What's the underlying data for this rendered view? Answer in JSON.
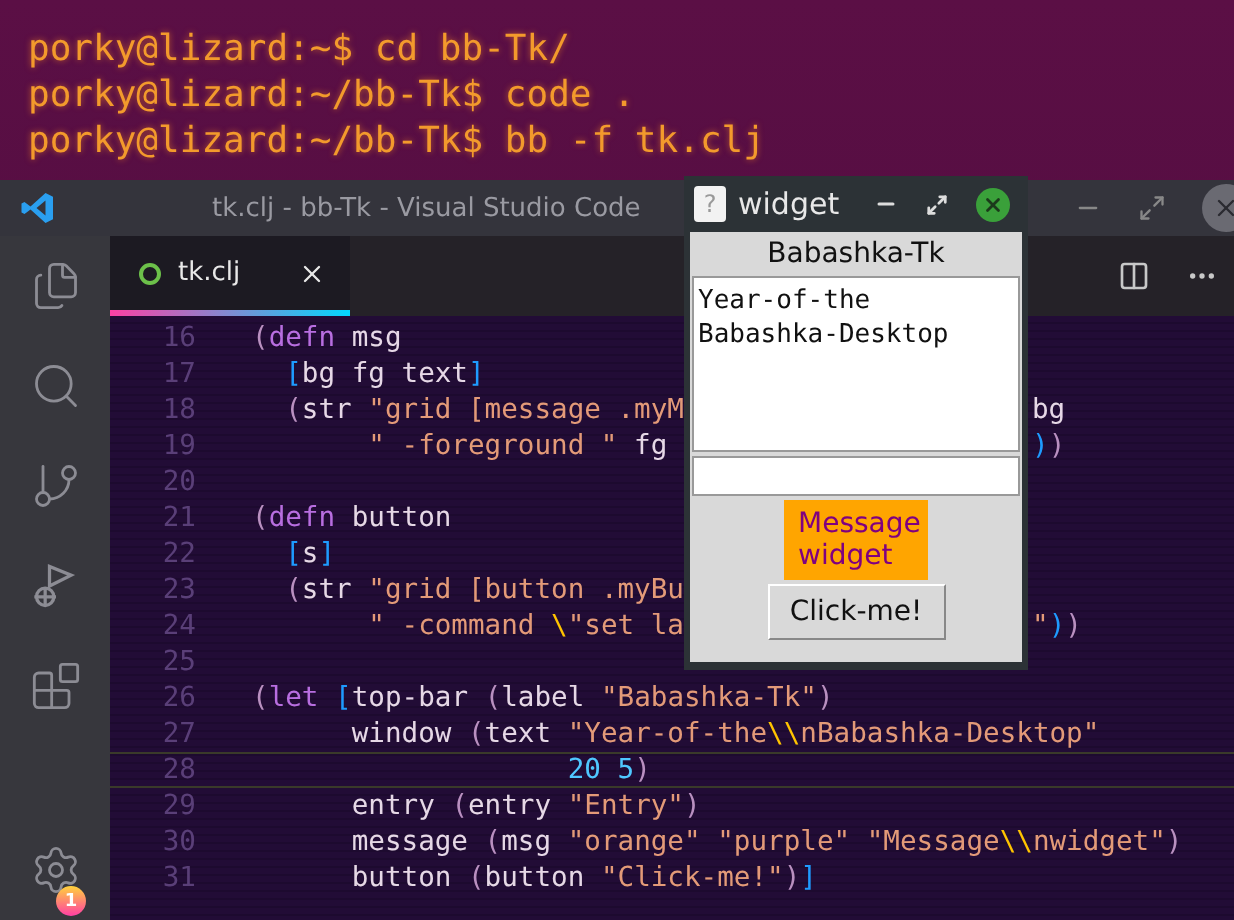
{
  "terminal": {
    "lines": [
      "porky@lizard:~$ cd bb-Tk/",
      "porky@lizard:~/bb-Tk$ code .",
      "porky@lizard:~/bb-Tk$ bb -f tk.clj"
    ]
  },
  "vscode": {
    "title": "tk.clj - bb-Tk - Visual Studio Code",
    "tabs": [
      {
        "label": "tk.clj",
        "selected": true
      }
    ],
    "settings_badge": "1",
    "lines": [
      {
        "number": "16",
        "current": false,
        "code": [
          {
            "text": "(",
            "kind": "paren"
          },
          {
            "text": "defn",
            "kind": "keyword"
          },
          {
            "text": " msg",
            "kind": "symbol"
          }
        ]
      },
      {
        "number": "17",
        "current": false,
        "code": [
          {
            "text": "  [",
            "kind": "bracket"
          },
          {
            "text": "bg fg text",
            "kind": "symbol"
          },
          {
            "text": "]",
            "kind": "bracket"
          }
        ]
      },
      {
        "number": "18",
        "current": false,
        "code": [
          {
            "text": "  (",
            "kind": "paren"
          },
          {
            "text": "str ",
            "kind": "symbol"
          },
          {
            "text": "\"grid [message .myM",
            "kind": "string"
          }
        ],
        "right": [
          {
            "text": "bg",
            "kind": "symbol"
          }
        ]
      },
      {
        "number": "19",
        "current": false,
        "code": [
          {
            "text": "       \" -foreground \"",
            "kind": "string"
          },
          {
            "text": " fg",
            "kind": "symbol"
          }
        ],
        "right": [
          {
            "text": ")",
            "kind": "bracket"
          },
          {
            "text": ")",
            "kind": "paren"
          }
        ]
      },
      {
        "number": "20",
        "current": false
      },
      {
        "number": "21",
        "current": false,
        "code": [
          {
            "text": "(",
            "kind": "paren"
          },
          {
            "text": "defn",
            "kind": "keyword"
          },
          {
            "text": " button",
            "kind": "symbol"
          }
        ]
      },
      {
        "number": "22",
        "current": false,
        "code": [
          {
            "text": "  [",
            "kind": "bracket"
          },
          {
            "text": "s",
            "kind": "symbol"
          },
          {
            "text": "]",
            "kind": "bracket"
          }
        ]
      },
      {
        "number": "23",
        "current": false,
        "code": [
          {
            "text": "  (",
            "kind": "paren"
          },
          {
            "text": "str ",
            "kind": "symbol"
          },
          {
            "text": "\"grid [button .myBu",
            "kind": "string"
          }
        ]
      },
      {
        "number": "24",
        "current": false,
        "code": [
          {
            "text": "       \" -command ",
            "kind": "string"
          },
          {
            "text": "\\",
            "kind": "escape"
          },
          {
            "text": "\"set la",
            "kind": "string"
          }
        ],
        "right": [
          {
            "text": "\"",
            "kind": "string"
          },
          {
            "text": ")",
            "kind": "bracket"
          },
          {
            "text": ")",
            "kind": "paren"
          }
        ]
      },
      {
        "number": "25",
        "current": false
      },
      {
        "number": "26",
        "current": false,
        "code": [
          {
            "text": "(",
            "kind": "paren"
          },
          {
            "text": "let ",
            "kind": "keyword"
          },
          {
            "text": "[",
            "kind": "bracket"
          },
          {
            "text": "top-bar ",
            "kind": "symbol"
          },
          {
            "text": "(",
            "kind": "paren"
          },
          {
            "text": "label ",
            "kind": "symbol"
          },
          {
            "text": "\"Babashka-Tk\"",
            "kind": "string"
          },
          {
            "text": ")",
            "kind": "paren"
          }
        ]
      },
      {
        "number": "27",
        "current": false,
        "code": [
          {
            "text": "      window ",
            "kind": "symbol"
          },
          {
            "text": "(",
            "kind": "paren"
          },
          {
            "text": "text ",
            "kind": "symbol"
          },
          {
            "text": "\"Year-of-the",
            "kind": "string"
          },
          {
            "text": "\\\\",
            "kind": "escape"
          },
          {
            "text": "nBabashka-Desktop\"",
            "kind": "string"
          }
        ]
      },
      {
        "number": "28",
        "current": true,
        "code": [
          {
            "text": "                   20 5",
            "kind": "number"
          },
          {
            "text": ")",
            "kind": "paren"
          }
        ]
      },
      {
        "number": "29",
        "current": false,
        "code": [
          {
            "text": "      entry ",
            "kind": "symbol"
          },
          {
            "text": "(",
            "kind": "paren"
          },
          {
            "text": "entry ",
            "kind": "symbol"
          },
          {
            "text": "\"Entry\"",
            "kind": "string"
          },
          {
            "text": ")",
            "kind": "paren"
          }
        ]
      },
      {
        "number": "30",
        "current": false,
        "code": [
          {
            "text": "      message ",
            "kind": "symbol"
          },
          {
            "text": "(",
            "kind": "paren"
          },
          {
            "text": "msg ",
            "kind": "symbol"
          },
          {
            "text": "\"orange\" \"purple\" \"Message",
            "kind": "string"
          },
          {
            "text": "\\\\",
            "kind": "escape"
          },
          {
            "text": "nwidget\"",
            "kind": "string"
          },
          {
            "text": ")",
            "kind": "paren"
          }
        ]
      },
      {
        "number": "31",
        "current": false,
        "code": [
          {
            "text": "      button ",
            "kind": "symbol"
          },
          {
            "text": "(",
            "kind": "paren"
          },
          {
            "text": "button ",
            "kind": "symbol"
          },
          {
            "text": "\"Click-me!\"",
            "kind": "string"
          },
          {
            "text": ")",
            "kind": "paren"
          },
          {
            "text": "]",
            "kind": "bracket"
          }
        ]
      }
    ]
  },
  "widget": {
    "app_icon": "?",
    "title": "widget",
    "label": "Babashka-Tk",
    "text_lines": [
      "Year-of-the",
      "Babashka-Desktop"
    ],
    "message_lines": [
      "Message",
      "widget"
    ],
    "button": "Click-me!"
  }
}
